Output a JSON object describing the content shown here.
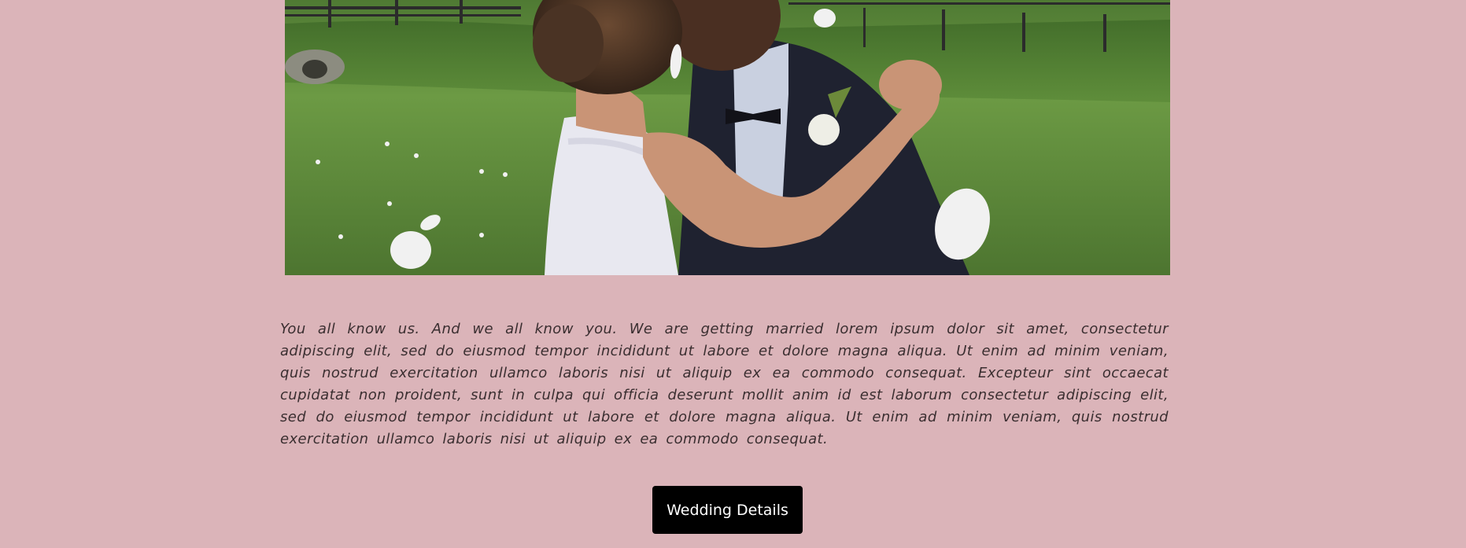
{
  "hero": {
    "image_subject": "wedding-couple-kissing-photo"
  },
  "intro": {
    "text": "You all know us. And we all know you. We are getting married lorem ipsum dolor sit amet, consectetur adipiscing elit, sed do eiusmod tempor incididunt ut labore et dolore magna aliqua. Ut enim ad minim veniam, quis nostrud exercitation ullamco laboris nisi ut aliquip ex ea commodo consequat. Excepteur sint occaecat cupidatat non proident, sunt in culpa qui officia deserunt mollit anim id est laborum consectetur adipiscing elit, sed do eiusmod tempor incididunt ut labore et dolore magna aliqua. Ut enim ad minim veniam, quis nostrud exercitation ullamco laboris nisi ut aliquip ex ea commodo consequat."
  },
  "cta": {
    "label": "Wedding Details"
  },
  "colors": {
    "page_background": "#dbb4b9",
    "button_background": "#000000",
    "button_text": "#ffffff",
    "body_text": "#3a2e30"
  }
}
